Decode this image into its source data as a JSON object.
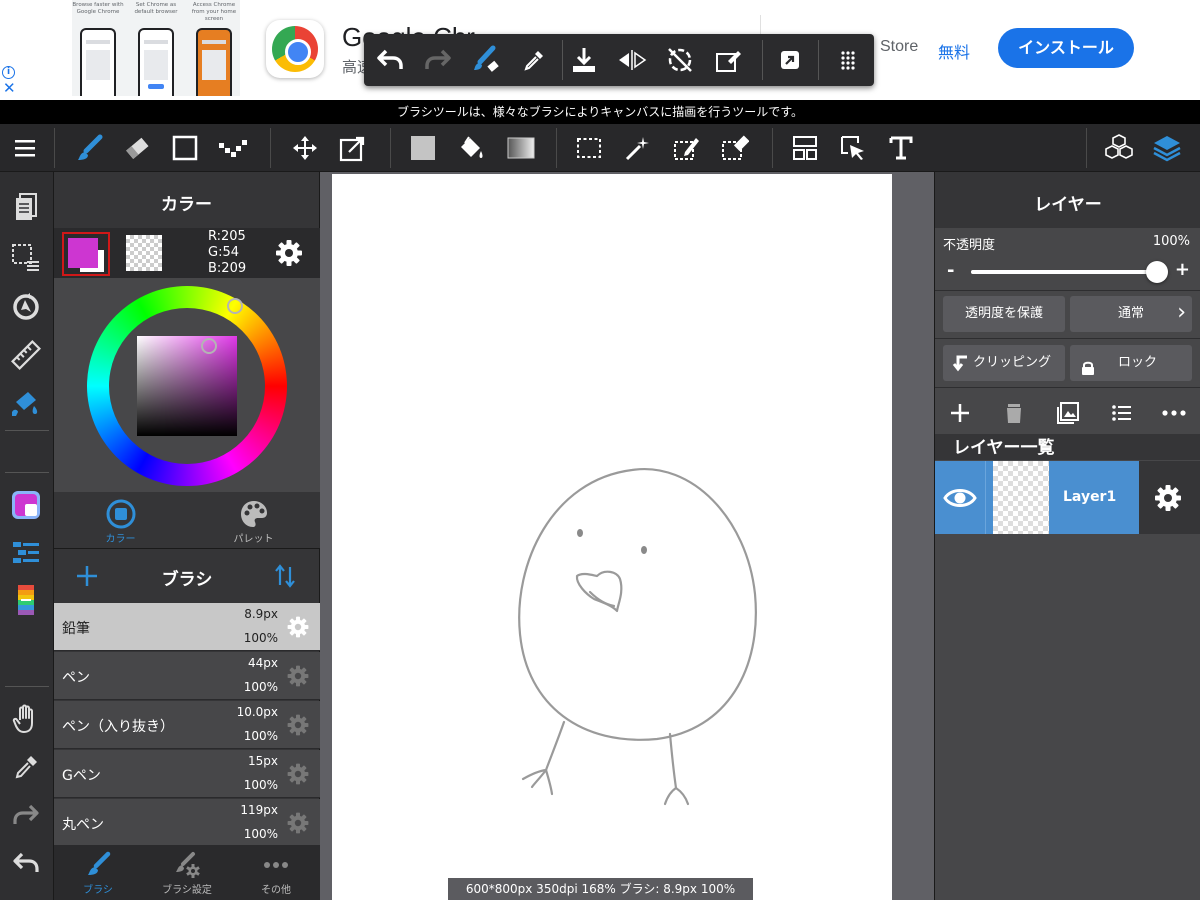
{
  "ad": {
    "screenshots": [
      {
        "caption": "Browse faster with Google Chrome"
      },
      {
        "caption": "Set Chrome as default browser"
      },
      {
        "caption": "Access Chrome from your home screen"
      }
    ],
    "app_title": "Google Chr",
    "app_subtitle": "高速",
    "store_label": "Store",
    "price": "無料",
    "install_label": "インストール",
    "close_glyph": "✕",
    "info_glyph": "i"
  },
  "quick_toolbar": {
    "icons": [
      "undo-icon",
      "redo-icon",
      "brush-eraser-toggle-icon",
      "eyedropper-icon",
      "save-icon",
      "flip-horizontal-icon",
      "rotate-reset-icon",
      "clear-selection-icon",
      "fullscreen-exit-icon",
      "grid-menu-icon"
    ]
  },
  "tip": "ブラシツールは、様々なブラシによりキャンバスに描画を行うツールです。",
  "toolbar": {
    "tools": [
      "menu-icon",
      "brush-icon",
      "eraser-icon",
      "rectangle-icon",
      "dotted-line-icon",
      "move-icon",
      "transform-icon",
      "fill-color-icon",
      "bucket-icon",
      "gradient-icon",
      "select-rect-icon",
      "magic-wand-icon",
      "select-pen-icon",
      "select-eraser-icon",
      "layout-icon",
      "operation-icon",
      "text-icon",
      "materials-icon",
      "layers-icon"
    ]
  },
  "left_strip": {
    "tools": [
      "pages-icon",
      "selection-menu-icon",
      "snap-icon",
      "ruler-icon",
      "filter-icon",
      "color-icon",
      "brush-list-icon",
      "palette-icon",
      "hand-icon",
      "eyedropper-icon",
      "redo-icon",
      "undo-icon"
    ]
  },
  "color_panel": {
    "title": "カラー",
    "rgb": {
      "r": "R:205",
      "g": "G:54",
      "b": "B:209"
    },
    "foreground": "#cd36d1",
    "background": "#ffffff",
    "tabs": [
      {
        "label": "カラー",
        "active": true
      },
      {
        "label": "パレット",
        "active": false
      }
    ]
  },
  "brush_panel": {
    "title": "ブラシ",
    "brushes": [
      {
        "name": "鉛筆",
        "size": "8.9px",
        "opacity": "100%",
        "selected": true
      },
      {
        "name": "ペン",
        "size": "44px",
        "opacity": "100%",
        "selected": false
      },
      {
        "name": "ペン（入り抜き）",
        "size": "10.0px",
        "opacity": "100%",
        "selected": false
      },
      {
        "name": "Gペン",
        "size": "15px",
        "opacity": "100%",
        "selected": false
      },
      {
        "name": "丸ペン",
        "size": "119px",
        "opacity": "100%",
        "selected": false
      }
    ],
    "tabs": [
      {
        "label": "ブラシ",
        "active": true
      },
      {
        "label": "ブラシ設定",
        "active": false
      },
      {
        "label": "その他",
        "active": false
      }
    ]
  },
  "canvas": {
    "status": "600*800px 350dpi 168% ブラシ: 8.9px 100%"
  },
  "layer_panel": {
    "title": "レイヤー",
    "opacity_label": "不透明度",
    "opacity_value": "100%",
    "opacity_fraction": 1.0,
    "minus": "-",
    "plus": "+",
    "protect_alpha": "透明度を保護",
    "blend_mode": "通常",
    "blend_chevron": "›",
    "clipping": "クリッピング",
    "lock": "ロック",
    "list_title": "レイヤー一覧",
    "layers": [
      {
        "name": "Layer1",
        "visible": true,
        "selected": true
      }
    ]
  },
  "colors": {
    "accent": "#4a8fd0",
    "icon_blue": "#2f8fd8",
    "panel": "#353537",
    "panel_light": "#474749",
    "toolbar": "#28282a",
    "canvas_bg": "#606065"
  }
}
